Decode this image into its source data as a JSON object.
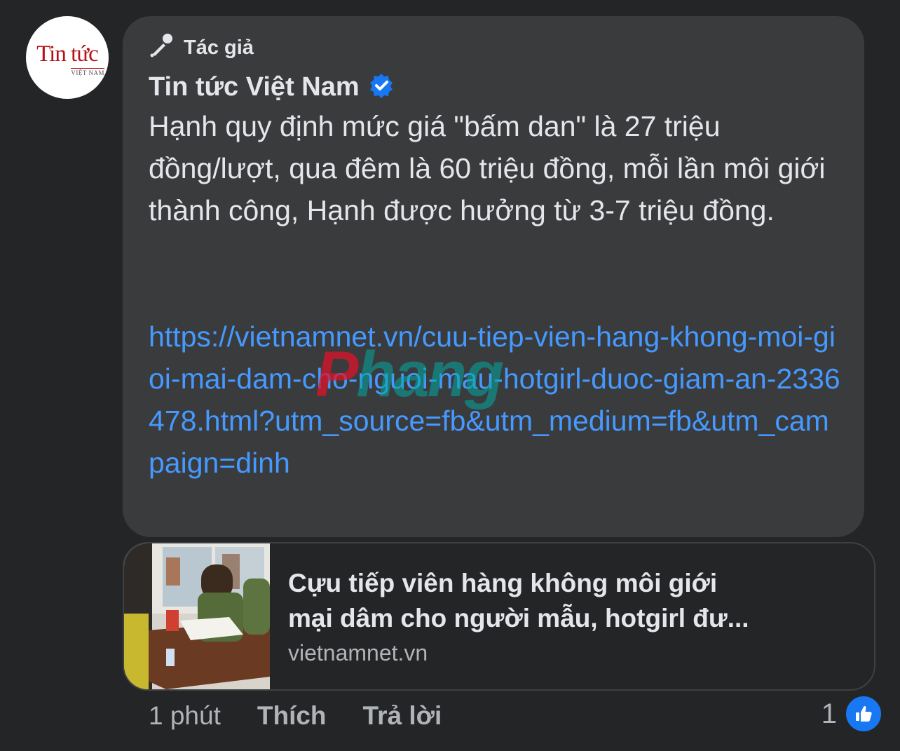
{
  "avatar": {
    "logo_main": "Tin tức",
    "logo_sub": "VIỆT NAM"
  },
  "comment": {
    "badge_label": "Tác giả",
    "author_name": "Tin tức Việt Nam",
    "body": "Hạnh quy định mức giá \"bấm dan\" là 27 triệu đồng/lượt, qua đêm là 60 triệu đồng, mỗi lần môi giới thành công, Hạnh được hưởng từ 3-7 triệu đồng.",
    "link": "https://vietnamnet.vn/cuu-tiep-vien-hang-khong-moi-gioi-mai-dam-cho-nguoi-mau-hotgirl-duoc-giam-an-2336478.html?utm_source=fb&utm_medium=fb&utm_campaign=dinh"
  },
  "watermark": {
    "text_red": "P",
    "text_teal": "hang"
  },
  "link_preview": {
    "title_line1": "Cựu tiếp viên hàng không môi giới",
    "title_line2": "mại dâm cho người mẫu, hotgirl đư...",
    "domain": "vietnamnet.vn"
  },
  "actions": {
    "time": "1 phút",
    "like": "Thích",
    "reply": "Trả lời"
  },
  "reactions": {
    "count": "1",
    "icon": "thumbs-up-icon"
  },
  "colors": {
    "background": "#242526",
    "bubble": "#3a3b3c",
    "text": "#e4e6eb",
    "link": "#4599ff",
    "muted": "#b0b3b8",
    "verified": "#1877f2"
  }
}
